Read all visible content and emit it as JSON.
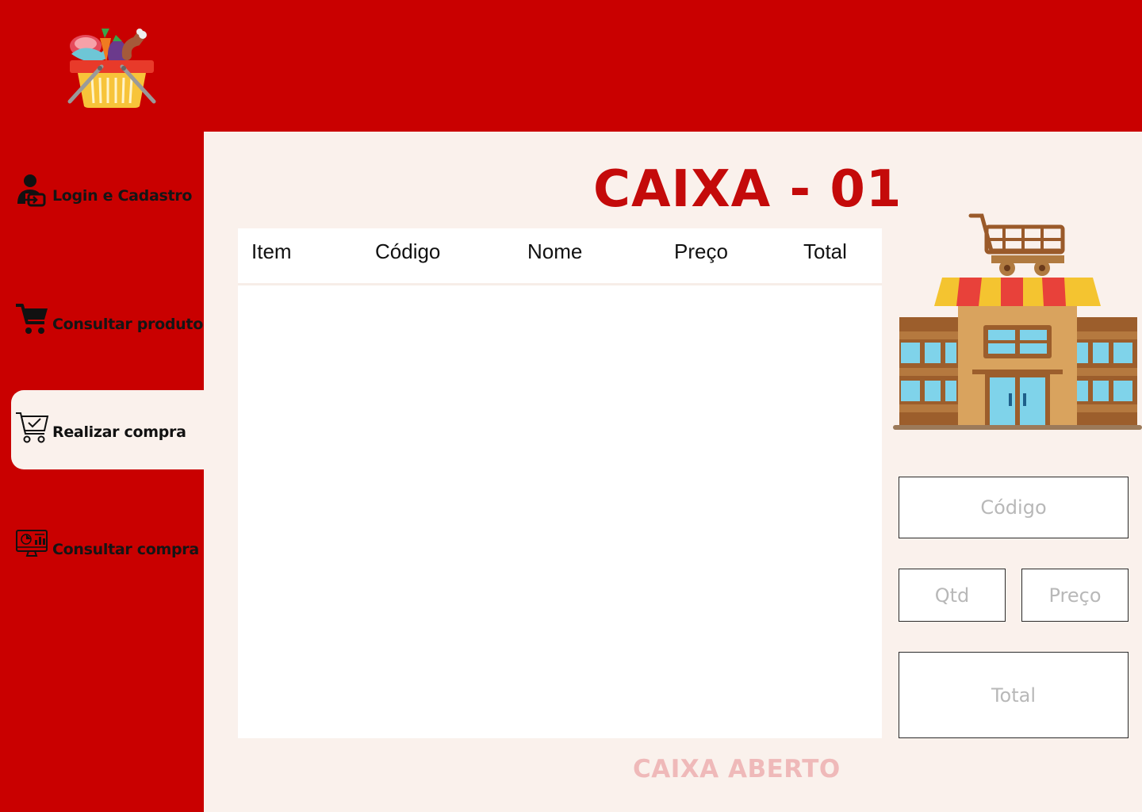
{
  "logo": {
    "icon": "grocery-basket-icon"
  },
  "sidebar": {
    "items": [
      {
        "label": "Login e Cadastro",
        "icon": "user-login-icon",
        "active": false
      },
      {
        "label": "Consultar produto",
        "icon": "shopping-cart-icon",
        "active": false
      },
      {
        "label": "Realizar compra",
        "icon": "cart-check-icon",
        "active": true
      },
      {
        "label": "Consultar compra",
        "icon": "dashboard-monitor-icon",
        "active": false
      }
    ]
  },
  "main": {
    "title": "CAIXA - 01",
    "table": {
      "columns": [
        "Item",
        "Código",
        "Nome",
        "Preço",
        "Total"
      ],
      "rows": []
    },
    "illustration": "supermarket-store-icon",
    "fields": {
      "codigo_placeholder": "Código",
      "qtd_placeholder": "Qtd",
      "preco_placeholder": "Preço",
      "total_placeholder": "Total"
    },
    "status": "CAIXA ABERTO"
  },
  "colors": {
    "brand_red": "#c90000",
    "title_red": "#c40a0a",
    "panel_bg": "#faf1ec",
    "status_pink": "#efb9b9"
  }
}
